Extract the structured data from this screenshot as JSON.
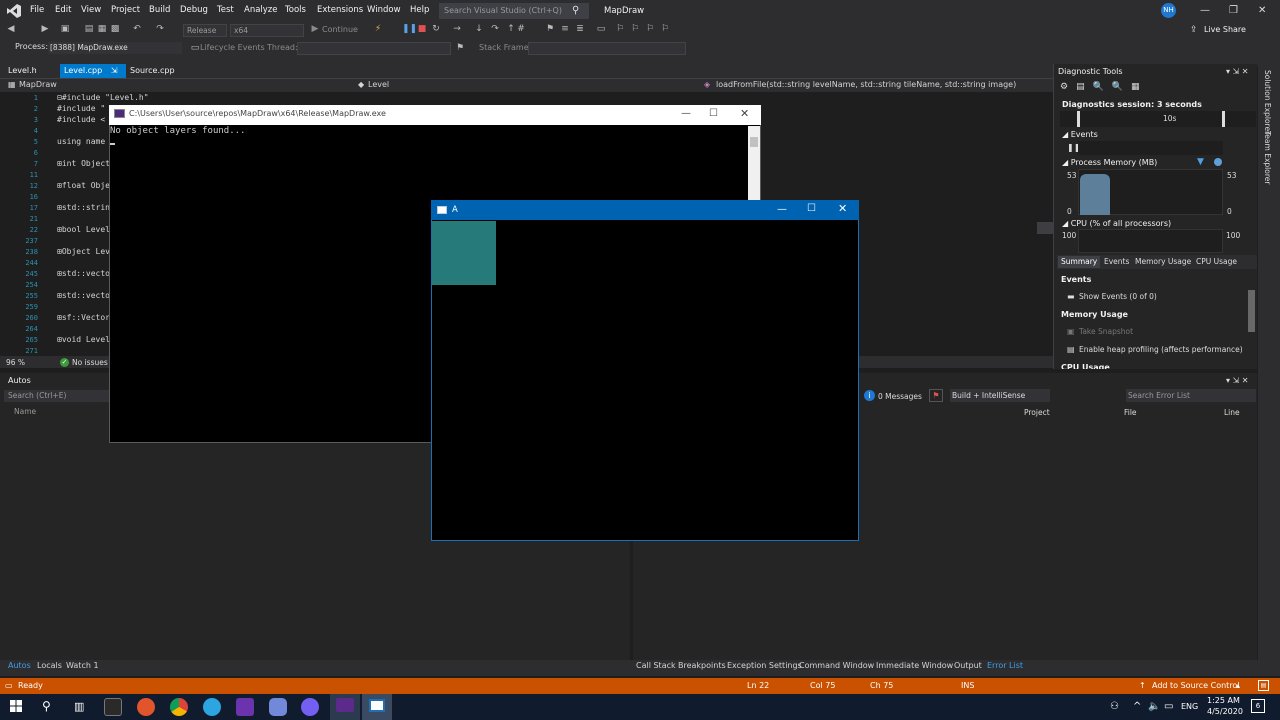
{
  "menu": [
    "File",
    "Edit",
    "View",
    "Project",
    "Build",
    "Debug",
    "Test",
    "Analyze",
    "Tools",
    "Extensions",
    "Window",
    "Help"
  ],
  "search": {
    "placeholder": "Search Visual Studio (Ctrl+Q)"
  },
  "app_name": "MapDraw",
  "user_initials": "NH",
  "live_share": "Live Share",
  "toolbar": {
    "config": "Release",
    "platform": "x64",
    "continue": "Continue",
    "lifecycle": "Lifecycle Events",
    "thread_label": "Thread:",
    "stack_label": "Stack Frame:"
  },
  "process": {
    "label": "Process:",
    "value": "[8388] MapDraw.exe"
  },
  "tabs": [
    {
      "label": "Level.h"
    },
    {
      "label": "Level.cpp"
    },
    {
      "label": "Source.cpp"
    }
  ],
  "nav": {
    "project": "MapDraw",
    "scope": "Level",
    "member": "loadFromFile(std::string levelName, std::string tileName, std::string image)"
  },
  "gutter": [
    "1",
    "2",
    "3",
    "4",
    "5",
    "6",
    "7",
    "11",
    "12",
    "16",
    "17",
    "21",
    "22",
    "237",
    "238",
    "244",
    "245",
    "254",
    "255",
    "259",
    "260",
    "264",
    "265",
    "271"
  ],
  "code": [
    {
      "line": 0,
      "text": "⊟#include \"Level.h\""
    },
    {
      "line": 1,
      "text": " #include \""
    },
    {
      "line": 2,
      "text": " #include <"
    },
    {
      "line": 4,
      "text": " using name"
    },
    {
      "line": 6,
      "text": "⊞int Object"
    },
    {
      "line": 8,
      "text": "⊞float Obje"
    },
    {
      "line": 10,
      "text": "⊞std::strin"
    },
    {
      "line": 12,
      "text": "⊞bool Level"
    },
    {
      "line": 14,
      "text": "⊞Object Lev"
    },
    {
      "line": 16,
      "text": "⊞std::vecto"
    },
    {
      "line": 18,
      "text": "⊞std::vecto"
    },
    {
      "line": 20,
      "text": "⊞sf::Vector"
    },
    {
      "line": 22,
      "text": "⊞void Level"
    }
  ],
  "zoom": "96 %",
  "issues": "No issues f",
  "diagnostics": {
    "title": "Diagnostic Tools",
    "session": "Diagnostics session: 3 seconds",
    "timeline_label": "10s",
    "events_label": "Events",
    "memory_label": "Process Memory (MB)",
    "memory_max": "53",
    "memory_min": "0",
    "cpu_label": "CPU (% of all processors)",
    "cpu_max": "100",
    "tabs": [
      "Summary",
      "Events",
      "Memory Usage",
      "CPU Usage"
    ],
    "summary_events": "Events",
    "show_events": "Show Events (0 of 0)",
    "memory_usage": "Memory Usage",
    "take_snapshot": "Take Snapshot",
    "heap_profiling": "Enable heap profiling (affects performance)",
    "cpu_usage": "CPU Usage"
  },
  "side_tabs": [
    "Solution Explorer",
    "Team Explorer"
  ],
  "autos": {
    "title": "Autos",
    "search": "Search (Ctrl+E)",
    "col_name": "Name"
  },
  "errors": {
    "messages": "0 Messages",
    "build_scope": "Build + IntelliSense",
    "search": "Search Error List",
    "cols": [
      "Project",
      "File",
      "Line"
    ]
  },
  "bottom_left_tabs": [
    "Autos",
    "Locals",
    "Watch 1"
  ],
  "bottom_right_tabs": [
    "Call Stack",
    "Breakpoints",
    "Exception Settings",
    "Command Window",
    "Immediate Window",
    "Output",
    "Error List"
  ],
  "status": {
    "ready": "Ready",
    "ln": "Ln 22",
    "col": "Col 75",
    "ch": "Ch 75",
    "ins": "INS",
    "source_control": "Add to Source Control"
  },
  "console": {
    "title": "C:\\Users\\User\\source\\repos\\MapDraw\\x64\\Release\\MapDraw.exe",
    "output": "No object layers found..."
  },
  "sfml_window": {
    "title": "A",
    "tile_color": "#267a7a"
  },
  "taskbar": {
    "time": "1:25 AM",
    "date": "4/5/2020",
    "lang": "ENG",
    "notif": "6"
  },
  "colors": {
    "accent": "#007acc",
    "status_bar": "#ca5100",
    "sfml_title": "#0063b1"
  }
}
